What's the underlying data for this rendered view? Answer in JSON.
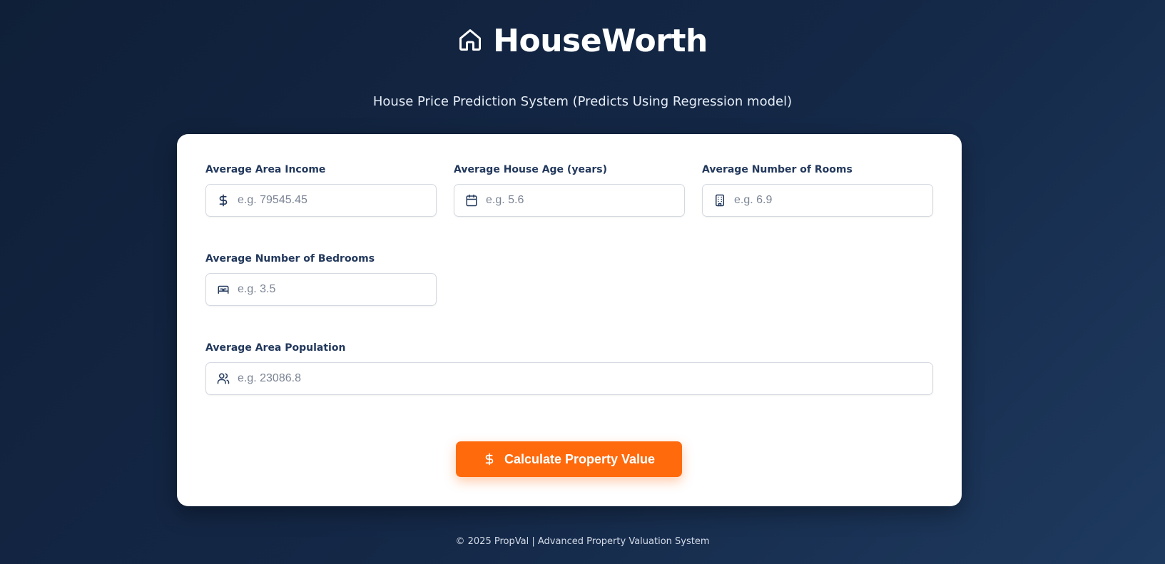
{
  "header": {
    "title": "HouseWorth",
    "subtitle": "House Price Prediction System (Predicts Using Regression model)"
  },
  "form": {
    "fields": [
      {
        "label": "Average Area Income",
        "placeholder": "e.g. 79545.45",
        "value": "",
        "icon": "dollar-icon"
      },
      {
        "label": "Average House Age (years)",
        "placeholder": "e.g. 5.6",
        "value": "",
        "icon": "calendar-icon"
      },
      {
        "label": "Average Number of Rooms",
        "placeholder": "e.g. 6.9",
        "value": "",
        "icon": "building-icon"
      },
      {
        "label": "Average Number of Bedrooms",
        "placeholder": "e.g. 3.5",
        "value": "",
        "icon": "bed-icon"
      },
      {
        "label": "Average Area Population",
        "placeholder": "e.g. 23086.8",
        "value": "",
        "icon": "users-icon"
      }
    ],
    "submit_label": "Calculate Property Value"
  },
  "footer": {
    "text": "© 2025 PropVal | Advanced Property Valuation System"
  },
  "colors": {
    "background": "#142847",
    "card": "#ffffff",
    "label": "#22385c",
    "accent": "#ff6a0d"
  }
}
